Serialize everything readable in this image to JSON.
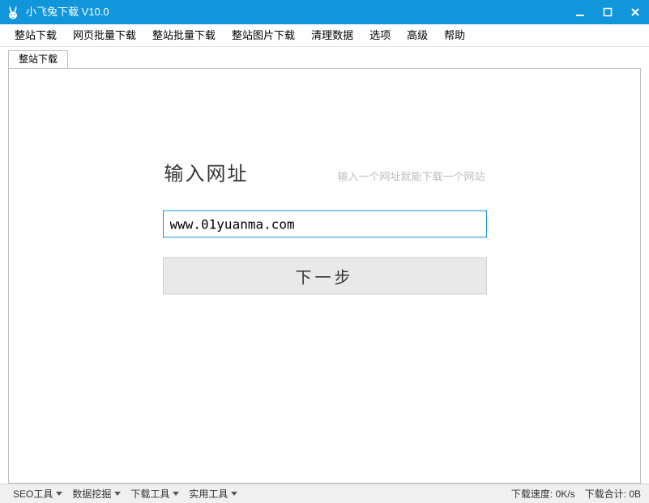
{
  "titlebar": {
    "title": "小飞兔下载 V10.0"
  },
  "menubar": {
    "items": [
      {
        "label": "整站下载"
      },
      {
        "label": "网页批量下载"
      },
      {
        "label": "整站批量下载"
      },
      {
        "label": "整站图片下载"
      },
      {
        "label": "清理数据"
      },
      {
        "label": "选项"
      },
      {
        "label": "高级"
      },
      {
        "label": "帮助"
      }
    ]
  },
  "tabs": {
    "items": [
      {
        "label": "整站下载"
      }
    ]
  },
  "main": {
    "heading": "输入网址",
    "subheading": "输入一个网址就能下载一个网站",
    "url_value": "www.01yuanma.com",
    "next_label": "下一步"
  },
  "statusbar": {
    "tools": [
      {
        "label": "SEO工具"
      },
      {
        "label": "数据挖掘"
      },
      {
        "label": "下载工具"
      },
      {
        "label": "实用工具"
      }
    ],
    "speed_label": "下载速度:",
    "speed_value": "0K/s",
    "total_label": "下载合计:",
    "total_value": "0B"
  },
  "colors": {
    "brand_blue": "#1296db"
  }
}
